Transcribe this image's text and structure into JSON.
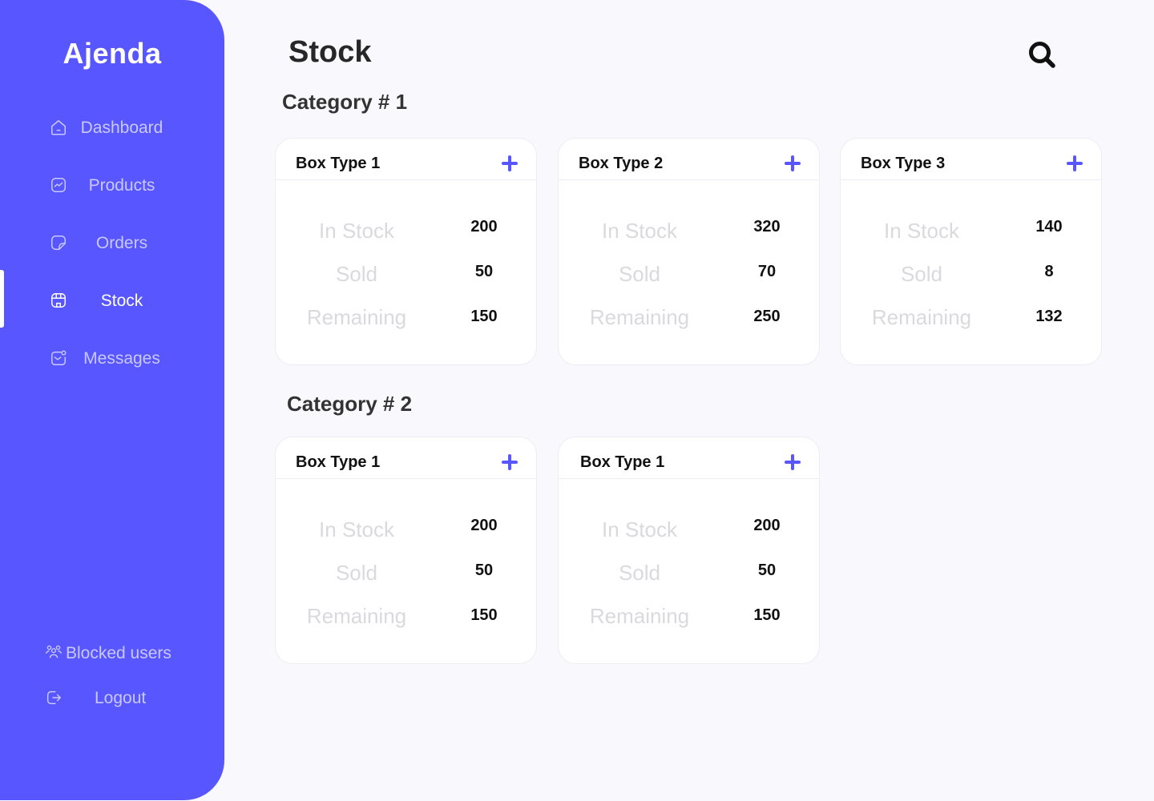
{
  "app": {
    "brand": "Ajenda"
  },
  "sidebar": {
    "items": [
      {
        "label": "Dashboard",
        "icon": "home-icon"
      },
      {
        "label": "Products",
        "icon": "chart-icon"
      },
      {
        "label": "Orders",
        "icon": "document-icon"
      },
      {
        "label": "Stock",
        "icon": "store-icon",
        "active": true
      },
      {
        "label": "Messages",
        "icon": "message-icon"
      }
    ],
    "bottom_items": [
      {
        "label": "Blocked users",
        "icon": "users-icon"
      },
      {
        "label": "Logout",
        "icon": "logout-icon"
      }
    ]
  },
  "page": {
    "title": "Stock",
    "search_icon": "search-icon"
  },
  "categories": [
    {
      "title": "Category # 1",
      "cards": [
        {
          "title": "Box Type 1",
          "rows": [
            {
              "label": "In Stock",
              "value": "200"
            },
            {
              "label": "Sold",
              "value": "50"
            },
            {
              "label": "Remaining",
              "value": "150"
            }
          ]
        },
        {
          "title": "Box Type 2",
          "rows": [
            {
              "label": "In Stock",
              "value": "320"
            },
            {
              "label": "Sold",
              "value": "70"
            },
            {
              "label": "Remaining",
              "value": "250"
            }
          ]
        },
        {
          "title": "Box Type 3",
          "rows": [
            {
              "label": "In Stock",
              "value": "140"
            },
            {
              "label": "Sold",
              "value": "8"
            },
            {
              "label": "Remaining",
              "value": "132"
            }
          ]
        }
      ]
    },
    {
      "title": "Category # 2",
      "cards": [
        {
          "title": "Box Type 1",
          "rows": [
            {
              "label": "In Stock",
              "value": "200"
            },
            {
              "label": "Sold",
              "value": "50"
            },
            {
              "label": "Remaining",
              "value": "150"
            }
          ]
        },
        {
          "title": "Box Type 1",
          "rows": [
            {
              "label": "In Stock",
              "value": "200"
            },
            {
              "label": "Sold",
              "value": "50"
            },
            {
              "label": "Remaining",
              "value": "150"
            }
          ]
        }
      ]
    }
  ],
  "colors": {
    "accent": "#5856fe",
    "background": "#f8f8fd",
    "muted_label": "#d9d9de",
    "nav_inactive": "#c9c8ff"
  }
}
